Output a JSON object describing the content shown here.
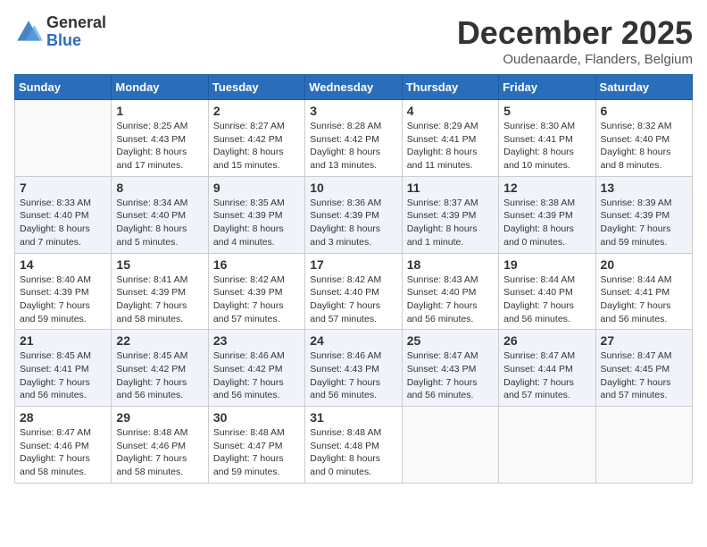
{
  "logo": {
    "general": "General",
    "blue": "Blue"
  },
  "title": "December 2025",
  "location": "Oudenaarde, Flanders, Belgium",
  "days_of_week": [
    "Sunday",
    "Monday",
    "Tuesday",
    "Wednesday",
    "Thursday",
    "Friday",
    "Saturday"
  ],
  "weeks": [
    [
      {
        "day": "",
        "info": ""
      },
      {
        "day": "1",
        "info": "Sunrise: 8:25 AM\nSunset: 4:43 PM\nDaylight: 8 hours\nand 17 minutes."
      },
      {
        "day": "2",
        "info": "Sunrise: 8:27 AM\nSunset: 4:42 PM\nDaylight: 8 hours\nand 15 minutes."
      },
      {
        "day": "3",
        "info": "Sunrise: 8:28 AM\nSunset: 4:42 PM\nDaylight: 8 hours\nand 13 minutes."
      },
      {
        "day": "4",
        "info": "Sunrise: 8:29 AM\nSunset: 4:41 PM\nDaylight: 8 hours\nand 11 minutes."
      },
      {
        "day": "5",
        "info": "Sunrise: 8:30 AM\nSunset: 4:41 PM\nDaylight: 8 hours\nand 10 minutes."
      },
      {
        "day": "6",
        "info": "Sunrise: 8:32 AM\nSunset: 4:40 PM\nDaylight: 8 hours\nand 8 minutes."
      }
    ],
    [
      {
        "day": "7",
        "info": "Sunrise: 8:33 AM\nSunset: 4:40 PM\nDaylight: 8 hours\nand 7 minutes."
      },
      {
        "day": "8",
        "info": "Sunrise: 8:34 AM\nSunset: 4:40 PM\nDaylight: 8 hours\nand 5 minutes."
      },
      {
        "day": "9",
        "info": "Sunrise: 8:35 AM\nSunset: 4:39 PM\nDaylight: 8 hours\nand 4 minutes."
      },
      {
        "day": "10",
        "info": "Sunrise: 8:36 AM\nSunset: 4:39 PM\nDaylight: 8 hours\nand 3 minutes."
      },
      {
        "day": "11",
        "info": "Sunrise: 8:37 AM\nSunset: 4:39 PM\nDaylight: 8 hours\nand 1 minute."
      },
      {
        "day": "12",
        "info": "Sunrise: 8:38 AM\nSunset: 4:39 PM\nDaylight: 8 hours\nand 0 minutes."
      },
      {
        "day": "13",
        "info": "Sunrise: 8:39 AM\nSunset: 4:39 PM\nDaylight: 7 hours\nand 59 minutes."
      }
    ],
    [
      {
        "day": "14",
        "info": "Sunrise: 8:40 AM\nSunset: 4:39 PM\nDaylight: 7 hours\nand 59 minutes."
      },
      {
        "day": "15",
        "info": "Sunrise: 8:41 AM\nSunset: 4:39 PM\nDaylight: 7 hours\nand 58 minutes."
      },
      {
        "day": "16",
        "info": "Sunrise: 8:42 AM\nSunset: 4:39 PM\nDaylight: 7 hours\nand 57 minutes."
      },
      {
        "day": "17",
        "info": "Sunrise: 8:42 AM\nSunset: 4:40 PM\nDaylight: 7 hours\nand 57 minutes."
      },
      {
        "day": "18",
        "info": "Sunrise: 8:43 AM\nSunset: 4:40 PM\nDaylight: 7 hours\nand 56 minutes."
      },
      {
        "day": "19",
        "info": "Sunrise: 8:44 AM\nSunset: 4:40 PM\nDaylight: 7 hours\nand 56 minutes."
      },
      {
        "day": "20",
        "info": "Sunrise: 8:44 AM\nSunset: 4:41 PM\nDaylight: 7 hours\nand 56 minutes."
      }
    ],
    [
      {
        "day": "21",
        "info": "Sunrise: 8:45 AM\nSunset: 4:41 PM\nDaylight: 7 hours\nand 56 minutes."
      },
      {
        "day": "22",
        "info": "Sunrise: 8:45 AM\nSunset: 4:42 PM\nDaylight: 7 hours\nand 56 minutes."
      },
      {
        "day": "23",
        "info": "Sunrise: 8:46 AM\nSunset: 4:42 PM\nDaylight: 7 hours\nand 56 minutes."
      },
      {
        "day": "24",
        "info": "Sunrise: 8:46 AM\nSunset: 4:43 PM\nDaylight: 7 hours\nand 56 minutes."
      },
      {
        "day": "25",
        "info": "Sunrise: 8:47 AM\nSunset: 4:43 PM\nDaylight: 7 hours\nand 56 minutes."
      },
      {
        "day": "26",
        "info": "Sunrise: 8:47 AM\nSunset: 4:44 PM\nDaylight: 7 hours\nand 57 minutes."
      },
      {
        "day": "27",
        "info": "Sunrise: 8:47 AM\nSunset: 4:45 PM\nDaylight: 7 hours\nand 57 minutes."
      }
    ],
    [
      {
        "day": "28",
        "info": "Sunrise: 8:47 AM\nSunset: 4:46 PM\nDaylight: 7 hours\nand 58 minutes."
      },
      {
        "day": "29",
        "info": "Sunrise: 8:48 AM\nSunset: 4:46 PM\nDaylight: 7 hours\nand 58 minutes."
      },
      {
        "day": "30",
        "info": "Sunrise: 8:48 AM\nSunset: 4:47 PM\nDaylight: 7 hours\nand 59 minutes."
      },
      {
        "day": "31",
        "info": "Sunrise: 8:48 AM\nSunset: 4:48 PM\nDaylight: 8 hours\nand 0 minutes."
      },
      {
        "day": "",
        "info": ""
      },
      {
        "day": "",
        "info": ""
      },
      {
        "day": "",
        "info": ""
      }
    ]
  ]
}
